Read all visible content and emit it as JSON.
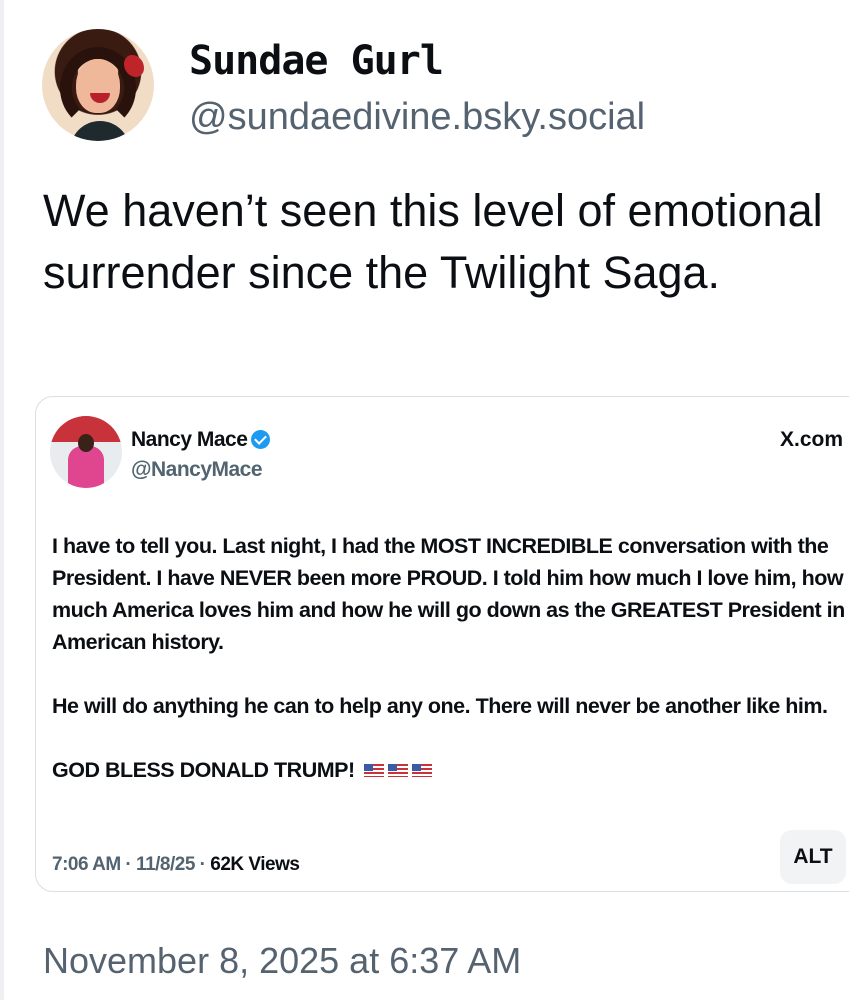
{
  "post": {
    "author": {
      "display_name": "Sundae Gurl",
      "handle": "@sundaedivine.bsky.social"
    },
    "text": "We haven’t seen this level of emotional surrender since the Twilight Saga.",
    "timestamp": "November 8, 2025 at 6:37 AM"
  },
  "quote": {
    "author": {
      "display_name": "Nancy Mace",
      "handle": "@NancyMace",
      "verified": true
    },
    "source": "X.com",
    "paragraphs": [
      "I have to tell you. Last night, I had the MOST INCREDIBLE conversation with the President. I have NEVER been more PROUD. I told him how much I love him, how much America loves him and how he will go down as the GREATEST President in American history.",
      "He will do anything he can to help any one. There will never be another like him.",
      "GOD BLESS DONALD TRUMP!"
    ],
    "flag_icons": [
      "us-flag-icon",
      "us-flag-icon",
      "us-flag-icon"
    ],
    "meta": {
      "time": "7:06 AM",
      "date": "11/8/25",
      "views": "62K Views"
    },
    "alt_label": "ALT"
  },
  "colors": {
    "verified": "#1d9bf0",
    "secondary_text": "#55626f",
    "card_border": "#d9dee3"
  }
}
